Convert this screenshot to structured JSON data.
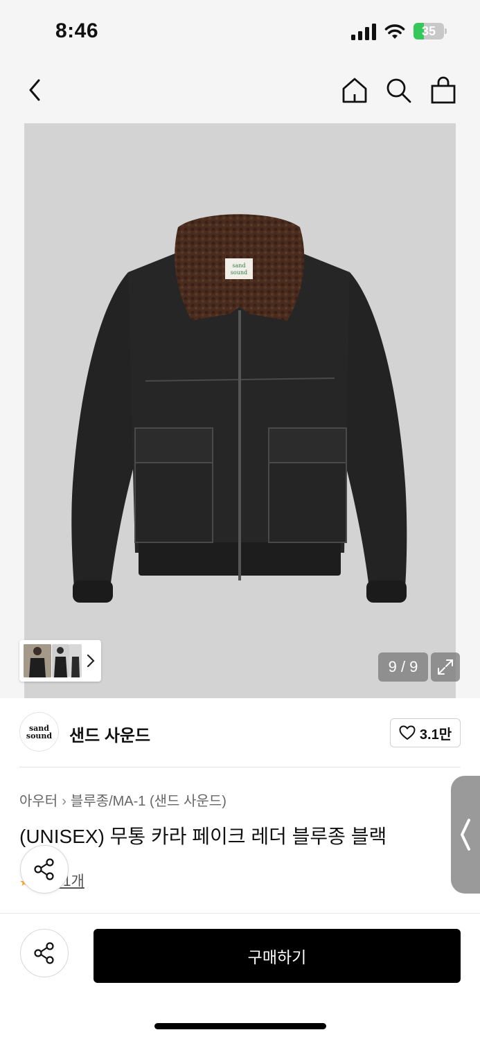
{
  "status_bar": {
    "time": "8:46",
    "battery_level": "35",
    "battery_color": "#34c759"
  },
  "nav": {
    "back_icon": "chevron-left-icon",
    "home_icon": "home-icon",
    "search_icon": "search-icon",
    "cart_icon": "shopping-bag-icon"
  },
  "gallery": {
    "counter": "9 / 9",
    "background": "#d3d3d3",
    "label_line1": "sand",
    "label_line2": "sound"
  },
  "brand": {
    "logo_line1": "sand",
    "logo_line2": "sound",
    "name": "샌드 사운드",
    "likes": "3.1만"
  },
  "breadcrumb": {
    "category": "아우터",
    "subcategory": "블루종/MA-1 (샌드 사운드)"
  },
  "product": {
    "title": "(UNISEX) 무통 카라 페이크 레더 블루종 블랙",
    "review_text": "후기 1개"
  },
  "actions": {
    "buy_label": "구매하기"
  }
}
